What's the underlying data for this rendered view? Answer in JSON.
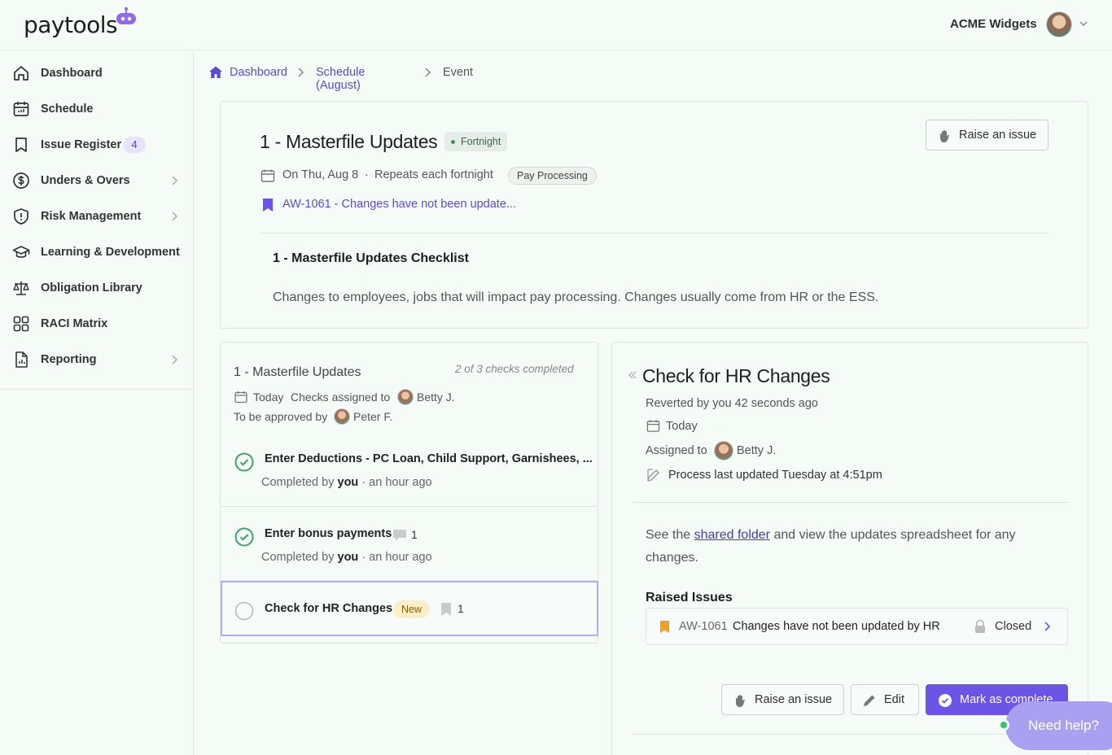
{
  "header": {
    "logo_text": "paytools",
    "org_name": "ACME Widgets"
  },
  "sidebar": {
    "items": [
      {
        "label": "Dashboard",
        "icon": "home-icon"
      },
      {
        "label": "Schedule",
        "icon": "calendar-icon"
      },
      {
        "label": "Issue Register",
        "icon": "bookmark-icon",
        "badge": "4"
      },
      {
        "label": "Unders & Overs",
        "icon": "dollar-icon",
        "has_children": true
      },
      {
        "label": "Risk Management",
        "icon": "shield-alert-icon",
        "has_children": true
      },
      {
        "label": "Learning & Development",
        "icon": "graduation-cap-icon"
      },
      {
        "label": "Obligation Library",
        "icon": "scales-icon"
      },
      {
        "label": "RACI Matrix",
        "icon": "grid-icon"
      },
      {
        "label": "Reporting",
        "icon": "report-icon",
        "has_children": true
      }
    ]
  },
  "breadcrumb": {
    "items": [
      "Dashboard",
      "Schedule (August)",
      "Event"
    ]
  },
  "event": {
    "title": "1 - Masterfile Updates",
    "frequency_tag": "Fortnight",
    "raise_issue_label": "Raise an issue",
    "date": "On Thu, Aug 8",
    "separator": "·",
    "repeat": "Repeats each fortnight",
    "category_tag": "Pay Processing",
    "linked_issue": "AW-1061 - Changes have not been update...",
    "checklist_title": "1 - Masterfile Updates Checklist",
    "checklist_description": "Changes to employees, jobs that will impact pay processing.  Changes usually come from HR or the ESS."
  },
  "checklist": {
    "title": "1 - Masterfile Updates",
    "progress": "2 of 3 checks completed",
    "today": "Today",
    "assigned_prefix": "Checks assigned to",
    "assignee": "Betty J.",
    "approved_prefix": "To be approved by",
    "approver": "Peter F.",
    "tasks": [
      {
        "name": "Enter Deductions - PC Loan, Child Support, Garnishees, ...",
        "completed_prefix": "Completed by",
        "completed_by": "you",
        "completed_when": "· an hour ago"
      },
      {
        "name": "Enter bonus payments",
        "comments": "1",
        "completed_prefix": "Completed by",
        "completed_by": "you",
        "completed_when": "· an hour ago"
      },
      {
        "name": "Check for HR Changes",
        "tag": "New",
        "issues": "1"
      }
    ]
  },
  "detail": {
    "title": "Check for HR Changes",
    "reverted": "Reverted by you 42 seconds ago",
    "today": "Today",
    "assigned_prefix": "Assigned to",
    "assignee": "Betty J.",
    "process_updated": "Process last updated Tuesday at 4:51pm",
    "desc_before": "See the ",
    "desc_link": "shared folder",
    "desc_after": " and view the updates spreadsheet for any changes.",
    "raised_issues_title": "Raised Issues",
    "issue": {
      "id": "AW-1061",
      "text": "Changes have not been updated by HR",
      "status": "Closed"
    },
    "buttons": {
      "raise": "Raise an issue",
      "edit": "Edit",
      "complete": "Mark as complete"
    }
  },
  "help": {
    "label": "Need help?"
  },
  "colors": {
    "accent": "#6b54e6",
    "success": "#3aa46a",
    "warning_flag": "#f0a020"
  }
}
